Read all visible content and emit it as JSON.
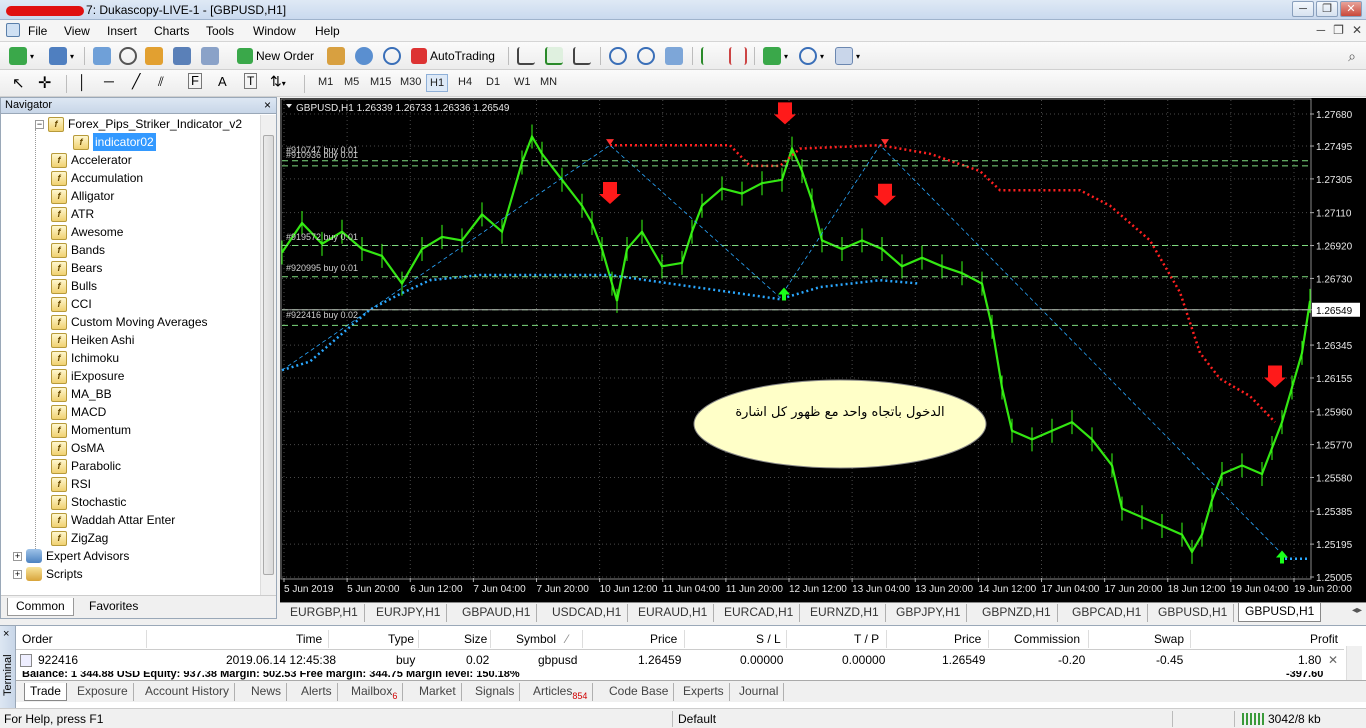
{
  "window": {
    "title": "Dukascopy-LIVE-1 - [GBPUSD,H1]",
    "title_prefix": "7",
    "controls": [
      "─",
      "❐",
      "✕"
    ]
  },
  "menu": [
    "File",
    "View",
    "Insert",
    "Charts",
    "Tools",
    "Window",
    "Help"
  ],
  "mdi_controls": [
    "─",
    "❐",
    "✕"
  ],
  "toolbar": {
    "new_order": "New Order",
    "auto_trading": "AutoTrading"
  },
  "timeframes": [
    "M1",
    "M5",
    "M15",
    "M30",
    "H1",
    "H4",
    "D1",
    "W1",
    "MN"
  ],
  "active_timeframe": "H1",
  "navigator": {
    "title": "Navigator",
    "close": "×",
    "parent": "Forex_Pips_Striker_Indicator_v2",
    "selected": "indicator02",
    "items": [
      "Accelerator",
      "Accumulation",
      "Alligator",
      "ATR",
      "Awesome",
      "Bands",
      "Bears",
      "Bulls",
      "CCI",
      "Custom Moving Averages",
      "Heiken Ashi",
      "Ichimoku",
      "iExposure",
      "MA_BB",
      "MACD",
      "Momentum",
      "OsMA",
      "Parabolic",
      "RSI",
      "Stochastic",
      "Waddah Attar Enter",
      "ZigZag"
    ],
    "groups": [
      "Expert Advisors",
      "Scripts"
    ],
    "tabs": [
      "Common",
      "Favorites"
    ]
  },
  "chart_data": {
    "type": "line",
    "symbol_info": "GBPUSD,H1  1.26339 1.26733 1.26336 1.26549",
    "current_price": "1.26549",
    "y_ticks": [
      "1.27680",
      "1.27495",
      "1.27305",
      "1.27110",
      "1.26920",
      "1.26730",
      "1.26549",
      "1.26345",
      "1.26155",
      "1.25960",
      "1.25770",
      "1.25580",
      "1.25385",
      "1.25195",
      "1.25005"
    ],
    "x_ticks": [
      "5 Jun 2019",
      "5 Jun 20:00",
      "6 Jun 12:00",
      "7 Jun 04:00",
      "7 Jun 20:00",
      "10 Jun 12:00",
      "11 Jun 04:00",
      "11 Jun 20:00",
      "12 Jun 12:00",
      "13 Jun 04:00",
      "13 Jun 20:00",
      "14 Jun 12:00",
      "17 Jun 04:00",
      "17 Jun 20:00",
      "18 Jun 12:00",
      "19 Jun 04:00",
      "19 Jun 20:00"
    ],
    "order_labels": [
      "#910747 buy 0.01",
      "#910936 buy 0.01",
      "#919572 buy 0.01",
      "#920995 buy 0.01",
      "#922416 buy 0.02"
    ],
    "annotation": "الدخول باتجاه واحد مع ظهور كل اشارة",
    "colors": {
      "candles": "#39ff14",
      "sell_line": "#ff2020",
      "buy_line": "#2aa8ff",
      "grid": "#4a4a4a",
      "level": "#7fdc7f"
    }
  },
  "chart_tabs": [
    "EURGBP,H1",
    "EURJPY,H1",
    "GBPAUD,H1",
    "USDCAD,H1",
    "EURAUD,H1",
    "EURCAD,H1",
    "EURNZD,H1",
    "GBPJPY,H1",
    "GBPNZD,H1",
    "GBPCAD,H1",
    "GBPUSD,H1",
    "GBPUSD,H1"
  ],
  "active_chart_tab": "GBPUSD,H1",
  "terminal": {
    "side_label": "Terminal",
    "columns": [
      "Order",
      "Time",
      "Type",
      "Size",
      "Symbol",
      "Price",
      "S / L",
      "T / P",
      "Price",
      "Commission",
      "Swap",
      "Profit"
    ],
    "rows": [
      {
        "order": "922416",
        "time": "2019.06.14 12:45:38",
        "type": "buy",
        "size": "0.02",
        "symbol": "gbpusd",
        "price": "1.26459",
        "sl": "0.00000",
        "tp": "0.00000",
        "cur_price": "1.26549",
        "commission": "-0.20",
        "swap": "-0.45",
        "profit": "1.80"
      }
    ],
    "summary": "Balance: 1 344.88 USD  Equity: 937.38  Margin: 502.53  Free margin: 344.75  Margin level: 150.18%",
    "summary_profit": "-397.60",
    "tabs": [
      "Trade",
      "Exposure",
      "Account History",
      "News",
      "Alerts",
      "Mailbox",
      "Market",
      "Signals",
      "Articles",
      "Code Base",
      "Experts",
      "Journal"
    ],
    "mailbox_count": "6",
    "articles_count": "854"
  },
  "status": {
    "help": "For Help, press F1",
    "profile": "Default",
    "traffic": "3042/8 kb"
  }
}
